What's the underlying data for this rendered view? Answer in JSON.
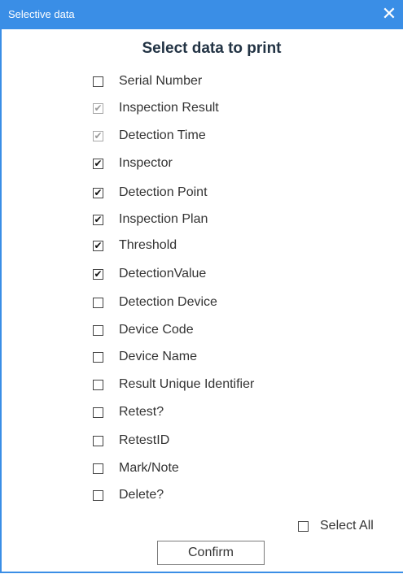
{
  "window": {
    "title": "Selective data",
    "close_glyph": "✕"
  },
  "dialog": {
    "heading": "Select data to print"
  },
  "options": [
    {
      "label": "Serial Number",
      "checked": false,
      "disabled": false
    },
    {
      "label": "Inspection Result",
      "checked": true,
      "disabled": true
    },
    {
      "label": "Detection Time",
      "checked": true,
      "disabled": true
    },
    {
      "label": "Inspector",
      "checked": true,
      "disabled": false
    },
    {
      "label": "Detection Point",
      "checked": true,
      "disabled": false
    },
    {
      "label": "Inspection Plan",
      "checked": true,
      "disabled": false
    },
    {
      "label": "Threshold",
      "checked": true,
      "disabled": false
    },
    {
      "label": "DetectionValue",
      "checked": true,
      "disabled": false
    },
    {
      "label": "Detection Device",
      "checked": false,
      "disabled": false
    },
    {
      "label": "Device Code",
      "checked": false,
      "disabled": false
    },
    {
      "label": "Device Name",
      "checked": false,
      "disabled": false
    },
    {
      "label": "Result Unique Identifier",
      "checked": false,
      "disabled": false
    },
    {
      "label": "Retest?",
      "checked": false,
      "disabled": false
    },
    {
      "label": "RetestID",
      "checked": false,
      "disabled": false
    },
    {
      "label": "Mark/Note",
      "checked": false,
      "disabled": false
    },
    {
      "label": "Delete?",
      "checked": false,
      "disabled": false
    }
  ],
  "select_all": {
    "label": "Select All",
    "checked": false
  },
  "confirm": {
    "label": "Confirm"
  },
  "colors": {
    "title_bar": "#3a8ee6",
    "heading_text": "#223344"
  }
}
